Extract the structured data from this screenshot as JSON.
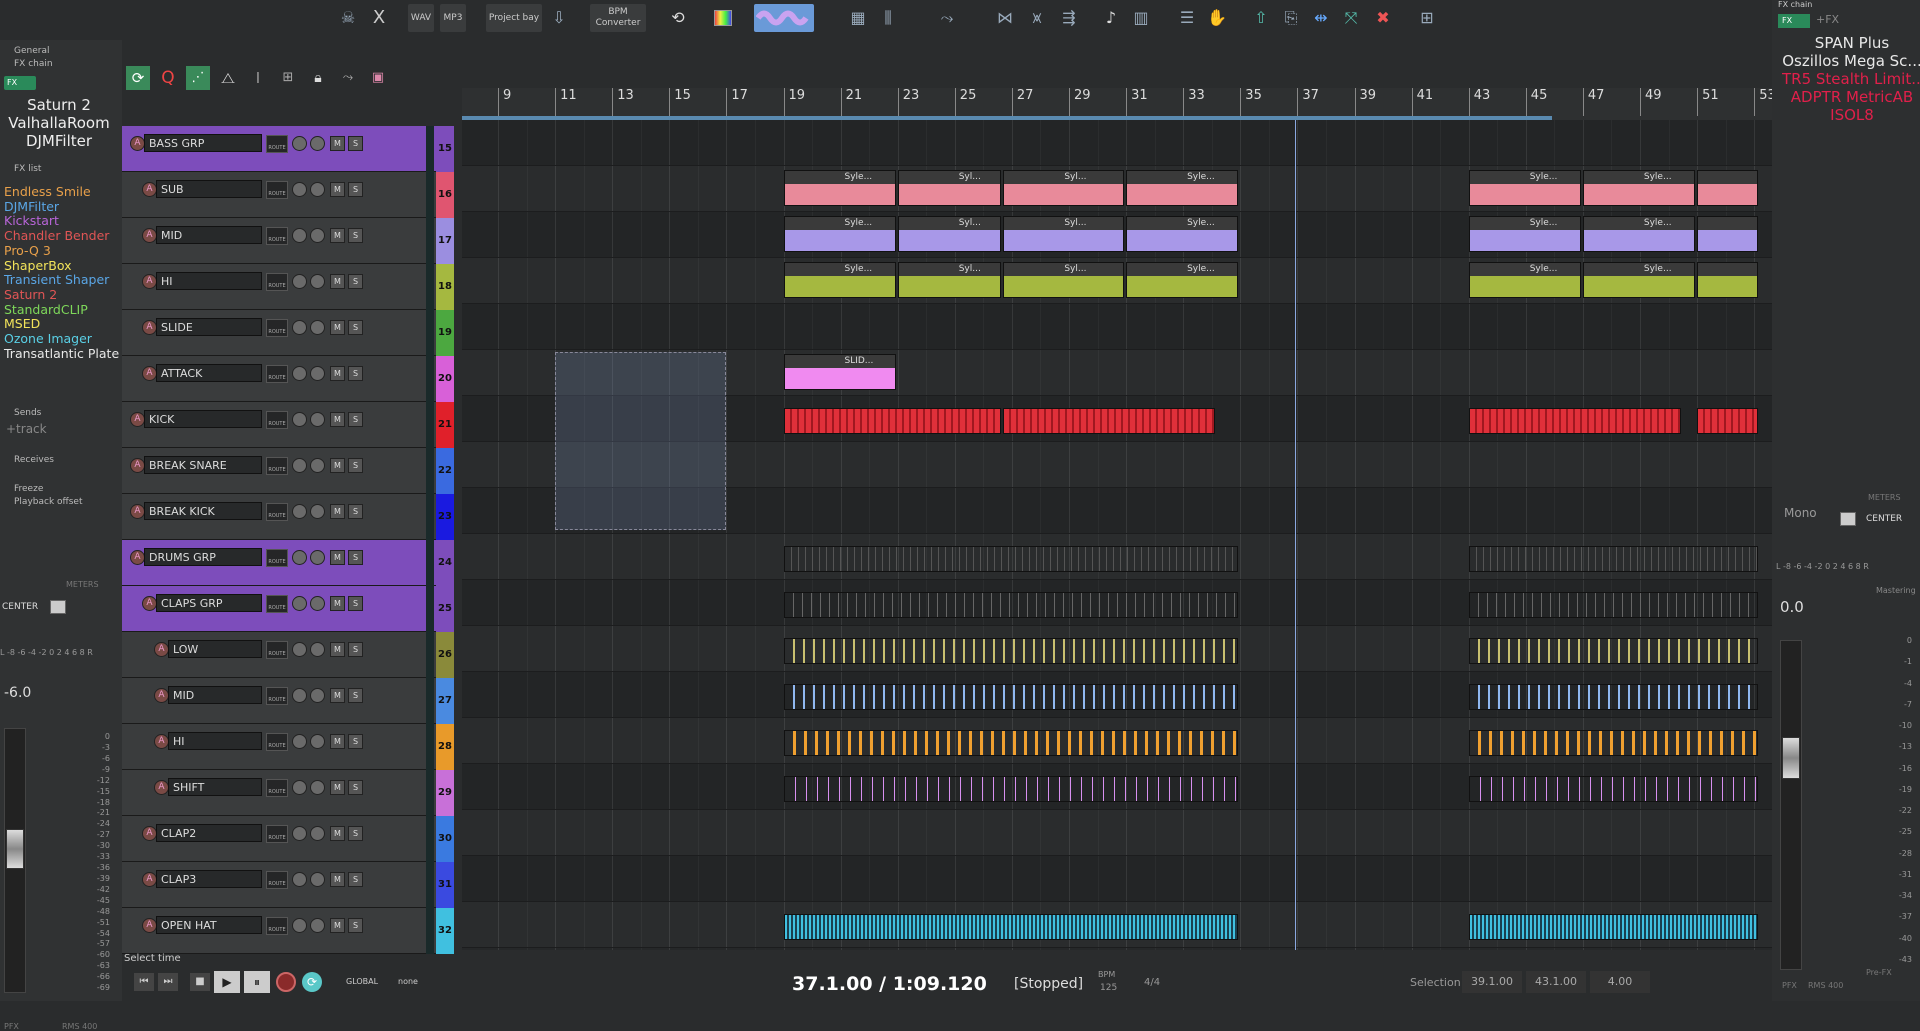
{
  "toolbar": {
    "wav": "WAV",
    "mp3": "MP3",
    "project_bay": "Project bay",
    "bpm_converter": "BPM Converter"
  },
  "left_panel": {
    "tabs": [
      "General",
      "FX chain"
    ],
    "fx_btn": "FX",
    "track_fx_names": [
      "Saturn 2",
      "ValhallaRoom",
      "DJMFilter"
    ],
    "fx_list_label": "FX list",
    "fx_list": [
      {
        "name": "Endless Smile",
        "color": "#e8a04a"
      },
      {
        "name": "DJMFilter",
        "color": "#5aa6e6"
      },
      {
        "name": "Kickstart",
        "color": "#b865d8"
      },
      {
        "name": "Chandler Bender",
        "color": "#e05555"
      },
      {
        "name": "Pro-Q 3",
        "color": "#e8a04a"
      },
      {
        "name": "ShaperBox",
        "color": "#f2e35a"
      },
      {
        "name": "Transient Shaper",
        "color": "#5aa6e6"
      },
      {
        "name": "Saturn 2",
        "color": "#e05555"
      },
      {
        "name": "StandardCLIP",
        "color": "#7ed85a"
      },
      {
        "name": "MSED",
        "color": "#f2e35a"
      },
      {
        "name": "Ozone Imager",
        "color": "#5ad0e6"
      },
      {
        "name": "Transatlantic Plate",
        "color": "#e8e8e8"
      }
    ],
    "sends_label": "Sends",
    "add_track": "+track",
    "receives_label": "Receives",
    "freeze_label": "Freeze",
    "playback_offset_label": "Playback offset",
    "meters_label": "METERS",
    "center_label": "CENTER",
    "pan_scale": "L -8 -6 -4 -2 0 2 4 6 8 R",
    "volume": "-6.0",
    "db_scale": [
      "0",
      "-3",
      "-6",
      "-9",
      "-12",
      "-15",
      "-18",
      "-21",
      "-24",
      "-27",
      "-30",
      "-33",
      "-36",
      "-39",
      "-42",
      "-45",
      "-48",
      "-51",
      "-54",
      "-57",
      "-60",
      "-63",
      "-66",
      "-69"
    ],
    "pfx": "PFX",
    "rms": "RMS 400"
  },
  "tracks": [
    {
      "name": "BASS GRP",
      "num": "15",
      "color": "#7d4dbb",
      "group": true,
      "indent": 0
    },
    {
      "name": "SUB",
      "num": "16",
      "color": "#e05570",
      "group": false,
      "indent": 1
    },
    {
      "name": "MID",
      "num": "17",
      "color": "#9b8ee0",
      "group": false,
      "indent": 1
    },
    {
      "name": "HI",
      "num": "18",
      "color": "#a5b840",
      "group": false,
      "indent": 1
    },
    {
      "name": "SLIDE",
      "num": "19",
      "color": "#4ca840",
      "group": false,
      "indent": 1
    },
    {
      "name": "ATTACK",
      "num": "20",
      "color": "#d860d8",
      "group": false,
      "indent": 1
    },
    {
      "name": "KICK",
      "num": "21",
      "color": "#e0202a",
      "group": false,
      "indent": 0
    },
    {
      "name": "BREAK SNARE",
      "num": "22",
      "color": "#3a6ae0",
      "group": false,
      "indent": 0
    },
    {
      "name": "BREAK KICK",
      "num": "23",
      "color": "#1a1ae0",
      "group": false,
      "indent": 0
    },
    {
      "name": "DRUMS GRP",
      "num": "24",
      "color": "#7d4dbb",
      "group": true,
      "indent": 0
    },
    {
      "name": "CLAPS GRP",
      "num": "25",
      "color": "#7d4dbb",
      "group": true,
      "indent": 1
    },
    {
      "name": "LOW",
      "num": "26",
      "color": "#8a8a3a",
      "group": false,
      "indent": 2
    },
    {
      "name": "MID",
      "num": "27",
      "color": "#4a8ae0",
      "group": false,
      "indent": 2
    },
    {
      "name": "HI",
      "num": "28",
      "color": "#e89a2a",
      "group": false,
      "indent": 2
    },
    {
      "name": "SHIFT",
      "num": "29",
      "color": "#c870d8",
      "group": false,
      "indent": 2
    },
    {
      "name": "CLAP2",
      "num": "30",
      "color": "#3a7ae0",
      "group": false,
      "indent": 1
    },
    {
      "name": "CLAP3",
      "num": "31",
      "color": "#3a4ae0",
      "group": false,
      "indent": 1
    },
    {
      "name": "OPEN HAT",
      "num": "32",
      "color": "#40c0e0",
      "group": false,
      "indent": 1
    }
  ],
  "track_buttons": {
    "route": "ROUTE",
    "mute": "M",
    "solo": "S",
    "rec": "A"
  },
  "ruler": [
    "9",
    "11",
    "13",
    "15",
    "17",
    "19",
    "21",
    "23",
    "25",
    "27",
    "29",
    "31",
    "33",
    "35",
    "37",
    "39",
    "41",
    "43",
    "45",
    "47",
    "49",
    "51",
    "53"
  ],
  "clips": {
    "syle_full": "Syle...",
    "syle_short": "Syl...",
    "slide": "SLID..."
  },
  "status": {
    "select_time": "Select time"
  },
  "transport": {
    "global": "GLOBAL",
    "none": "none",
    "position": "37.1.00 / 1:09.120",
    "state": "[Stopped]",
    "bpm_label": "BPM",
    "bpm": "125",
    "timesig": "4/4",
    "selection_label": "Selection:",
    "sel_start": "39.1.00",
    "sel_end": "43.1.00",
    "sel_len": "4.00"
  },
  "right_panel": {
    "fx_chain_label": "FX chain",
    "fx_btn": "FX",
    "add_fx": "+FX",
    "master_fx": [
      {
        "name": "SPAN Plus",
        "color": "#e8e8e8"
      },
      {
        "name": "Oszillos Mega Sc...",
        "color": "#e8e8e8"
      },
      {
        "name": "TR5 Stealth Limit...",
        "color": "#e0204a"
      },
      {
        "name": "ADPTR MetricAB",
        "color": "#e0204a"
      },
      {
        "name": "ISOL8",
        "color": "#e0204a"
      }
    ],
    "meters_label": "METERS",
    "mono_label": "Mono",
    "center_label": "CENTER",
    "pan_scale": "L -8 -6 -4 -2 0 2 4 6 8 R",
    "mastering": "Mastering",
    "volume": "0.0",
    "db_scale": [
      "0",
      "-1",
      "-4",
      "-7",
      "-10",
      "-13",
      "-16",
      "-19",
      "-22",
      "-25",
      "-28",
      "-31",
      "-34",
      "-37",
      "-40",
      "-43"
    ],
    "pre_fx": "Pre-FX",
    "pfx": "PFX",
    "rms": "RMS 400"
  }
}
